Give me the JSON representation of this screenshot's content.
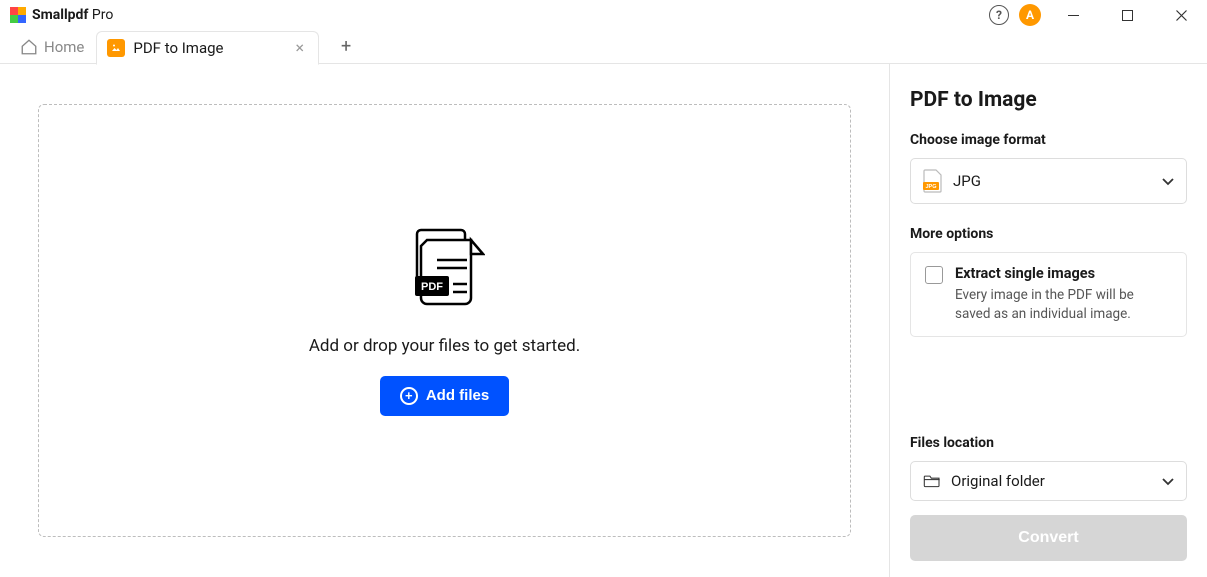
{
  "titlebar": {
    "app_name": "Smallpdf",
    "app_tier": "Pro",
    "avatar_initial": "A"
  },
  "tabs": {
    "home_label": "Home",
    "active_label": "PDF to Image"
  },
  "dropzone": {
    "text": "Add or drop your files to get started.",
    "button": "Add files"
  },
  "sidebar": {
    "title": "PDF to Image",
    "format_label": "Choose image format",
    "format_value": "JPG",
    "more_options_label": "More options",
    "extract_title": "Extract single images",
    "extract_desc": "Every image in the PDF will be saved as an individual image.",
    "files_location_label": "Files location",
    "files_location_value": "Original folder",
    "convert_label": "Convert"
  }
}
